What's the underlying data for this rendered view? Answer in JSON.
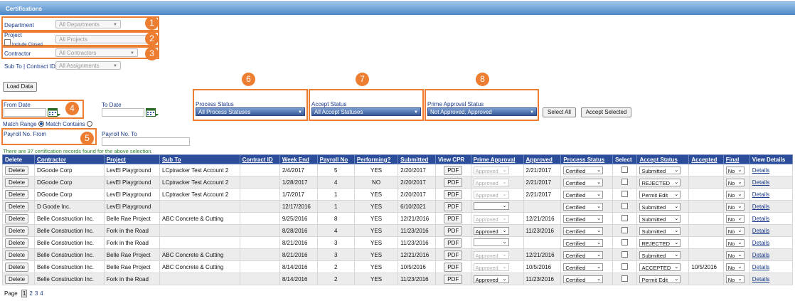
{
  "header": {
    "title": "Certifications"
  },
  "filters": {
    "department": {
      "label": "Department",
      "value": "All Departments"
    },
    "project": {
      "label": "Project",
      "value": "All Projects",
      "include_closed": "Include Closed"
    },
    "contractor": {
      "label": "Contractor",
      "value": "All Contractors"
    },
    "subto": {
      "label": "Sub To | Contract ID",
      "value": "All Assignments"
    },
    "load_button": "Load Data",
    "from_date": "From Date",
    "to_date": "To Date",
    "match_range": "Match Range",
    "match_contains": "Match Contains",
    "payroll_from": "Payroll No. From",
    "payroll_to": "Payroll No. To",
    "process_status": {
      "label": "Process Status",
      "value": "All Process Statuses"
    },
    "accept_status": {
      "label": "Accept Status",
      "value": "All Accept Statuses"
    },
    "prime_status": {
      "label": "Prime Approval Status",
      "value": "Not Approved, Approved"
    },
    "select_all": "Select All",
    "accept_selected": "Accept Selected",
    "found_msg": "There are 37 certification records found for the above selection."
  },
  "badges": [
    "1",
    "2",
    "3",
    "4",
    "5",
    "6",
    "7",
    "8"
  ],
  "table": {
    "headers": [
      "Delete",
      "Contractor",
      "Project",
      "Sub To",
      "Contract ID",
      "Week End",
      "Payroll No",
      "Performing?",
      "Submitted",
      "View CPR",
      "Prime Approval",
      "Approved",
      "Process Status",
      "Select",
      "Accept Status",
      "Accepted",
      "Final",
      "View Details"
    ],
    "rows": [
      {
        "contractor": "DGoode Corp",
        "project": "LevEl Playground",
        "subto": "LCptracker Test Account 2",
        "contract": "",
        "week": "2/4/2017",
        "payroll": "5",
        "perf": "YES",
        "submitted": "2/20/2017",
        "prime": "Approved",
        "prime_dis": true,
        "approved": "2/21/2017",
        "process": "Certified",
        "accept": "Submitted",
        "accepted": "",
        "final": "No"
      },
      {
        "contractor": "DGoode Corp",
        "project": "LevEl Playground",
        "subto": "LCptracker Test Account 2",
        "contract": "",
        "week": "1/28/2017",
        "payroll": "4",
        "perf": "NO",
        "submitted": "2/20/2017",
        "prime": "Approved",
        "prime_dis": true,
        "approved": "2/21/2017",
        "process": "Certified",
        "accept": "REJECTED",
        "accepted": "",
        "final": "No"
      },
      {
        "contractor": "DGoode Corp",
        "project": "LevEl Playground",
        "subto": "LCptracker Test Account 2",
        "contract": "",
        "week": "1/7/2017",
        "payroll": "1",
        "perf": "YES",
        "submitted": "2/20/2017",
        "prime": "Approved",
        "prime_dis": true,
        "approved": "2/21/2017",
        "process": "Certified",
        "accept": "Permit Edit",
        "accepted": "",
        "final": "No"
      },
      {
        "contractor": "D Goode Inc.",
        "project": "LevEl Playground",
        "subto": "",
        "contract": "",
        "week": "12/17/2016",
        "payroll": "1",
        "perf": "YES",
        "submitted": "6/10/2021",
        "prime": "",
        "prime_dis": false,
        "approved": "",
        "process": "Certified",
        "accept": "Submitted",
        "accepted": "",
        "final": "No"
      },
      {
        "contractor": "Belle Construction Inc.",
        "project": "Belle Rae Project",
        "subto": "ABC Concrete & Cutting",
        "contract": "",
        "week": "9/25/2016",
        "payroll": "8",
        "perf": "YES",
        "submitted": "12/21/2016",
        "prime": "Approved",
        "prime_dis": true,
        "approved": "12/21/2016",
        "process": "Certified",
        "accept": "Submitted",
        "accepted": "",
        "final": "No"
      },
      {
        "contractor": "Belle Construction Inc.",
        "project": "Fork in the Road",
        "subto": "",
        "contract": "",
        "week": "8/28/2016",
        "payroll": "4",
        "perf": "YES",
        "submitted": "11/23/2016",
        "prime": "Approved",
        "prime_dis": false,
        "approved": "11/23/2016",
        "process": "Certified",
        "accept": "Submitted",
        "accepted": "",
        "final": "No"
      },
      {
        "contractor": "Belle Construction Inc.",
        "project": "Fork in the Road",
        "subto": "",
        "contract": "",
        "week": "8/21/2016",
        "payroll": "3",
        "perf": "YES",
        "submitted": "11/23/2016",
        "prime": "",
        "prime_dis": false,
        "approved": "",
        "process": "Certified",
        "accept": "REJECTED",
        "accepted": "",
        "final": "No"
      },
      {
        "contractor": "Belle Construction Inc.",
        "project": "Belle Rae Project",
        "subto": "ABC Concrete & Cutting",
        "contract": "",
        "week": "8/21/2016",
        "payroll": "3",
        "perf": "YES",
        "submitted": "12/21/2016",
        "prime": "Approved",
        "prime_dis": true,
        "approved": "12/21/2016",
        "process": "Certified",
        "accept": "Submitted",
        "accepted": "",
        "final": "No"
      },
      {
        "contractor": "Belle Construction Inc.",
        "project": "Belle Rae Project",
        "subto": "ABC Concrete & Cutting",
        "contract": "",
        "week": "8/14/2016",
        "payroll": "2",
        "perf": "YES",
        "submitted": "10/5/2016",
        "prime": "Approved",
        "prime_dis": true,
        "approved": "10/5/2016",
        "process": "Certified",
        "accept": "ACCEPTED",
        "accepted": "10/5/2016",
        "final": "No"
      },
      {
        "contractor": "Belle Construction Inc.",
        "project": "Fork in the Road",
        "subto": "",
        "contract": "",
        "week": "8/14/2016",
        "payroll": "2",
        "perf": "YES",
        "submitted": "11/23/2016",
        "prime": "Approved",
        "prime_dis": false,
        "approved": "11/23/2016",
        "process": "Certified",
        "accept": "Permit Edit",
        "accepted": "",
        "final": "No"
      }
    ],
    "delete_label": "Delete",
    "pdf_label": "PDF",
    "details_label": "Details"
  },
  "pager": {
    "label": "Page",
    "pages": [
      "1",
      "2",
      "3",
      "4"
    ],
    "current": "1"
  }
}
